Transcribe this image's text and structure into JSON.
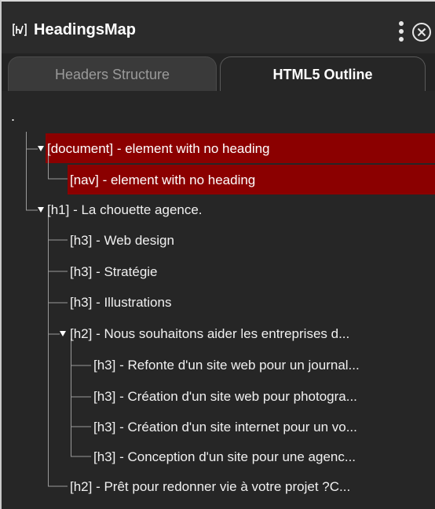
{
  "app": {
    "title": "HeadingsMap",
    "logo_text": "[h/]",
    "logo_icon": "headingsmap-logo-icon",
    "menu_icon": "vertical-dots-icon",
    "close_icon": "close-circle-icon"
  },
  "tabs": [
    {
      "label": "Headers Structure",
      "active": false
    },
    {
      "label": "HTML5 Outline",
      "active": true
    }
  ],
  "outline": {
    "root": ".",
    "highlight_color": "#8b0000",
    "items": [
      {
        "text": "[document] - element with no heading",
        "level": 1,
        "expandable": true,
        "error": true
      },
      {
        "text": "[nav] - element with no heading",
        "level": 2,
        "expandable": false,
        "error": true
      },
      {
        "text": "[h1] -  La chouette agence.",
        "level": 1,
        "expandable": true,
        "error": false
      },
      {
        "text": "[h3] -  Web design",
        "level": 2,
        "expandable": false,
        "error": false
      },
      {
        "text": "[h3] -  Stratégie",
        "level": 2,
        "expandable": false,
        "error": false
      },
      {
        "text": "[h3] -  Illustrations",
        "level": 2,
        "expandable": false,
        "error": false
      },
      {
        "text": "[h2] -  Nous souhaitons aider les entreprises d...",
        "level": 2,
        "expandable": true,
        "error": false
      },
      {
        "text": "[h3] -  Refonte d'un site web pour un journal...",
        "level": 3,
        "expandable": false,
        "error": false
      },
      {
        "text": "[h3] -  Création d'un site web pour photogra...",
        "level": 3,
        "expandable": false,
        "error": false
      },
      {
        "text": "[h3] -  Création d'un site internet pour un vo...",
        "level": 3,
        "expandable": false,
        "error": false
      },
      {
        "text": "[h3] -  Conception d'un site pour une agenc...",
        "level": 3,
        "expandable": false,
        "error": false
      },
      {
        "text": "[h2] -  Prêt pour redonner vie à votre projet ?C...",
        "level": 2,
        "expandable": false,
        "error": false
      }
    ]
  }
}
